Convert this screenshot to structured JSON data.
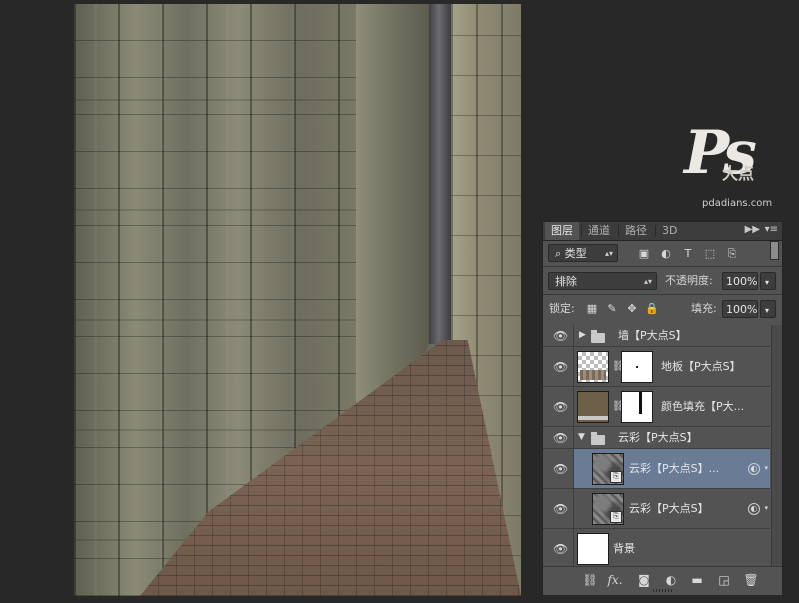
{
  "watermark": {
    "logo": "Ps",
    "logo_cn": "大点",
    "url": "pdadians.com"
  },
  "panel": {
    "tabs": [
      "图层",
      "通道",
      "路径",
      "3D"
    ],
    "filter": {
      "kind_label": "类型",
      "search_icon": "search-icon"
    },
    "blend_mode": "排除",
    "opacity_label": "不透明度:",
    "opacity_value": "100%",
    "lock_label": "锁定:",
    "fill_label": "填充:",
    "fill_value": "100%"
  },
  "layers": [
    {
      "name": "墙【P大点S】",
      "kind": "group",
      "collapsed": true
    },
    {
      "name": "地板【P大点S】",
      "kind": "pixel-with-mask"
    },
    {
      "name": "颜色填充【P大...",
      "kind": "fill-with-mask"
    },
    {
      "name": "云彩【P大点S】",
      "kind": "group",
      "collapsed": false
    },
    {
      "name": "云彩【P大点S】...",
      "kind": "smart-object",
      "selected": true
    },
    {
      "name": "云彩【P大点S】",
      "kind": "smart-object"
    },
    {
      "name": "背景",
      "kind": "background"
    }
  ],
  "footer_icons": [
    "link-icon",
    "fx-icon",
    "mask-icon",
    "adjustment-icon",
    "folder-icon",
    "new-layer-icon",
    "trash-icon"
  ],
  "footer_fx": "fx."
}
